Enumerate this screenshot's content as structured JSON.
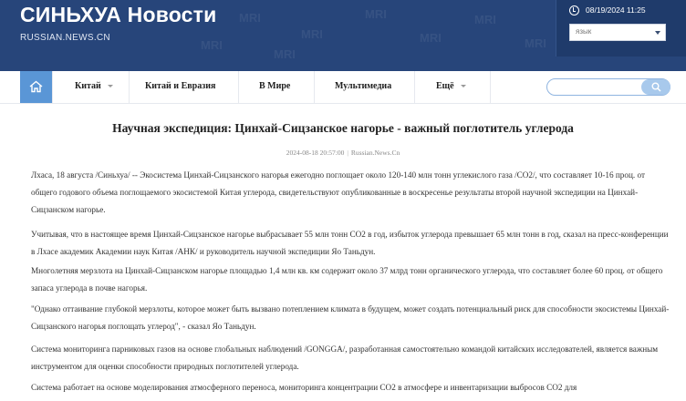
{
  "header": {
    "brand": "СИНЬХУА Новости",
    "domain": "RUSSIAN.NEWS.CN",
    "datetime": "08/19/2024 11:25",
    "language_select": "язык"
  },
  "nav": {
    "items": [
      {
        "label": "Китай",
        "dropdown": true
      },
      {
        "label": "Китай и Евразия",
        "dropdown": false
      },
      {
        "label": "В Мире",
        "dropdown": false
      },
      {
        "label": "Мультимедиа",
        "dropdown": false
      },
      {
        "label": "Ещё",
        "dropdown": true
      }
    ],
    "search_placeholder": ""
  },
  "article": {
    "title": "Научная экспедиция: Цинхай-Сицзанское нагорье - важный поглотитель углерода",
    "date": "2024-08-18 20:57:00",
    "source": "Russian.News.Cn",
    "paragraphs": [
      "Лхаса, 18 августа /Синьхуа/ -- Экосистема Цинхай-Сицзанского нагорья ежегодно поглощает около 120-140 млн тонн углекислого газа /CO2/, что составляет 10-16 проц. от общего годового объема поглощаемого экосистемой Китая углерода, свидетельствуют опубликованные в воскресенье результаты второй научной экспедиции на Цинхай-Сицзанском нагорье.",
      "Учитывая, что в настоящее время Цинхай-Сицзанское нагорье выбрасывает 55 млн тонн CO2 в год, избыток углерода превышает 65 млн тонн в год, сказал на пресс-конференции в Лхасе академик Академии наук Китая /АНК/ и руководитель научной экспедиции Яо Таньдун.",
      "Многолетняя мерзлота на Цинхай-Сицзанском нагорье площадью 1,4 млн кв. км содержит около 37 млрд тонн органического углерода, что составляет более 60 проц. от общего запаса углерода в почве нагорья.",
      "\"Однако оттаивание глубокой мерзлоты, которое может быть вызвано потеплением климата в будущем, может создать потенциальный риск для способности экосистемы Цинхай-Сицзанского нагорья поглощать углерод\", - сказал Яо Таньдун.",
      "Система мониторинга парниковых газов на основе глобальных наблюдений /GONGGA/, разработанная самостоятельно командой китайских исследователей, является важным инструментом для оценки способности природных поглотителей углерода.",
      "Система работает на основе моделирования атмосферного переноса, мониторинга концентрации CO2 в атмосфере и инвентаризации выбросов CO2 для"
    ]
  },
  "colors": {
    "header_bg": "#27457a",
    "home_button": "#5a96d6",
    "search_button": "#a8c9ec"
  }
}
